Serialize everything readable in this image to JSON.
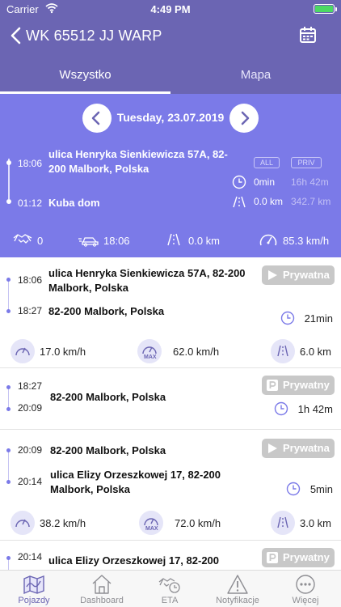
{
  "status_bar": {
    "carrier": "Carrier",
    "time": "4:49 PM"
  },
  "nav": {
    "title": "WK 65512 JJ WARP"
  },
  "tabs": [
    {
      "label": "Wszystko"
    },
    {
      "label": "Mapa"
    }
  ],
  "date": "Tuesday, 23.07.2019",
  "summary": {
    "start_time": "18:06",
    "start_address": "ulica Henryka Sienkiewicza 57A, 82-200 Malbork, Polska",
    "end_time": "01:12",
    "end_address": "Kuba dom",
    "badge_all": "ALL",
    "badge_priv": "PRIV",
    "time_all": "0min",
    "time_priv": "16h 42m",
    "dist_all": "0.0 km",
    "dist_priv": "342.7 km",
    "stats": {
      "handshakes": "0",
      "drive_time": "18:06",
      "distance": "0.0 km",
      "max_speed": "85.3 km/h"
    }
  },
  "trips": [
    {
      "start_time": "18:06",
      "start_address": "ulica Henryka Sienkiewicza 57A, 82-200 Malbork, Polska",
      "end_time": "18:27",
      "end_address": "82-200 Malbork, Polska",
      "tag": "Prywatna",
      "duration": "21min",
      "avg_speed": "17.0 km/h",
      "max_speed": "62.0 km/h",
      "max_label": "MAX",
      "distance": "6.0 km"
    },
    {
      "start_time": "18:27",
      "end_time": "20:09",
      "address": "82-200 Malbork, Polska",
      "tag": "Prywatny",
      "duration": "1h 42m"
    },
    {
      "start_time": "20:09",
      "start_address": "82-200 Malbork, Polska",
      "end_time": "20:14",
      "end_address": "ulica Elizy Orzeszkowej 17, 82-200 Malbork, Polska",
      "tag": "Prywatna",
      "duration": "5min",
      "avg_speed": "38.2 km/h",
      "max_speed": "72.0 km/h",
      "max_label": "MAX",
      "distance": "3.0 km"
    },
    {
      "start_time": "20:14",
      "start_address": "ulica Elizy Orzeszkowej 17, 82-200",
      "tag": "Prywatny"
    }
  ],
  "tabbar": [
    {
      "label": "Pojazdy"
    },
    {
      "label": "Dashboard"
    },
    {
      "label": "ETA"
    },
    {
      "label": "Notyfikacje"
    },
    {
      "label": "Więcej"
    }
  ],
  "colors": {
    "header": "#6b65b3",
    "summary": "#7b7ae8",
    "accent": "#6b65b3",
    "tag": "#c8c8c8"
  }
}
